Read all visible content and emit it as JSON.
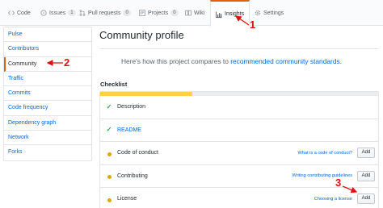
{
  "tabs": [
    {
      "label": "Code",
      "icon": "code-icon"
    },
    {
      "label": "Issues",
      "icon": "issue-icon",
      "count": "1"
    },
    {
      "label": "Pull requests",
      "icon": "pull-request-icon",
      "count": "0"
    },
    {
      "label": "Projects",
      "icon": "project-icon",
      "count": "0"
    },
    {
      "label": "Wiki",
      "icon": "book-icon"
    },
    {
      "label": "Insights",
      "icon": "graph-icon",
      "selected": true
    },
    {
      "label": "Settings",
      "icon": "gear-icon"
    }
  ],
  "sidebar": {
    "items": [
      {
        "label": "Pulse"
      },
      {
        "label": "Contributors"
      },
      {
        "label": "Community",
        "selected": true
      },
      {
        "label": "Traffic"
      },
      {
        "label": "Commits"
      },
      {
        "label": "Code frequency"
      },
      {
        "label": "Dependency graph"
      },
      {
        "label": "Network"
      },
      {
        "label": "Forks"
      }
    ]
  },
  "main": {
    "title": "Community profile",
    "intro_prefix": "Here's how this project compares to ",
    "intro_link": "recommended community standards",
    "intro_suffix": ".",
    "checklist_heading": "Checklist",
    "progress_fraction": 0.33,
    "items": [
      {
        "label": "Description",
        "status": "done"
      },
      {
        "label": "README",
        "status": "done",
        "is_link": true
      },
      {
        "label": "Code of conduct",
        "status": "missing",
        "help": "What is a code of conduct?",
        "action": "Add"
      },
      {
        "label": "Contributing",
        "status": "missing",
        "help": "Writing contributing guidelines",
        "action": "Add"
      },
      {
        "label": "License",
        "status": "missing",
        "help": "Choosing a license",
        "action": "Add"
      }
    ]
  },
  "annotations": {
    "one": "1",
    "two": "2",
    "three": "3"
  },
  "colors": {
    "accent": "#e36209",
    "link": "#0366d6",
    "done": "#28a745",
    "pending": "#dbab09",
    "progress": "#ffd33d",
    "annotation": "#dd1111"
  }
}
